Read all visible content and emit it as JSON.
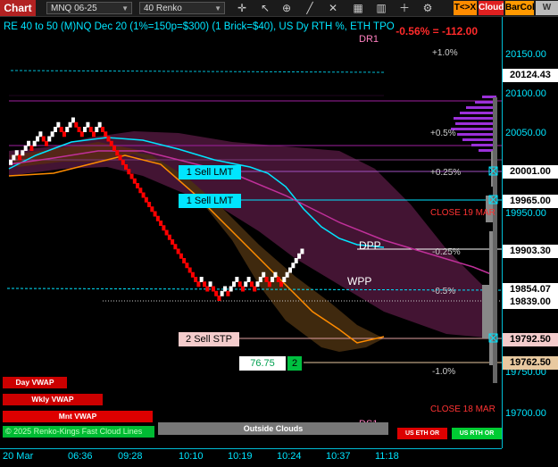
{
  "toolbar": {
    "chart_tab": "Chart",
    "instrument": "MNQ 06-25",
    "bar_type": "40 Renko",
    "buttons": [
      "T<>X",
      "Cloud",
      "BarCol",
      "W VV"
    ]
  },
  "header": {
    "indicator_text": "RE 40 to 50 (M)NQ Dec 20 (1%=150p=$300) (1 Brick=$40), US Dy RTH %, ETH TPO",
    "daily_change": "-0.56% = -112.00"
  },
  "price_axis": {
    "ticks": [
      "20150.00",
      "20100.00",
      "20050.00",
      "19950.00",
      "19750.00",
      "19700.00"
    ],
    "tags": [
      {
        "label": "20124.43",
        "color": "#ffffff"
      },
      {
        "label": "20001.00",
        "color": "#ffffff"
      },
      {
        "label": "19965.00",
        "color": "#ffffff"
      },
      {
        "label": "19903.30",
        "color": "#ffffff"
      },
      {
        "label": "19854.07",
        "color": "#ffffff"
      },
      {
        "label": "19839.00",
        "color": "#ffffff"
      },
      {
        "label": "19792.50",
        "color": "#f4cccc"
      },
      {
        "label": "19762.50",
        "color": "#e8c9a0"
      }
    ]
  },
  "time_axis": [
    "20 Mar",
    "06:36",
    "09:28",
    "10:10",
    "10:19",
    "10:24",
    "10:37",
    "11:18"
  ],
  "levels": {
    "plus_1": "+1.0%",
    "plus_05": "+0.5%",
    "plus_025": "+0.25%",
    "minus_025": "-0.25%",
    "minus_05": "-0.5%",
    "minus_1": "-1.0%",
    "dr1": "DR1",
    "ds1": "DS1",
    "dpp": "DPP",
    "wpp": "WPP",
    "close_19": "CLOSE 19 MAR",
    "close_18": "CLOSE 18 MAR"
  },
  "orders": [
    {
      "label": "1 Sell LMT"
    },
    {
      "label": "1 Sell LMT"
    },
    {
      "label": "2 Sell STP"
    }
  ],
  "position": {
    "price": "76.75",
    "qty": "2"
  },
  "vwap_buttons": [
    "Day VWAP",
    "Wkly VWAP",
    "Mnt VWAP"
  ],
  "status": {
    "footer": "© 2025 Renko-Kings Fast Cloud Lines",
    "outside_clouds": "Outside Clouds"
  },
  "session_buttons": [
    "US ETH OR",
    "US RTH OR"
  ],
  "colors": {
    "accent": "#00e5ff",
    "down_brick": "#ff0000",
    "up_brick": "#ffffff",
    "profile": "#9b30d9",
    "cloud_purple": "#4a1a3a",
    "cloud_orange": "#4a3010"
  }
}
